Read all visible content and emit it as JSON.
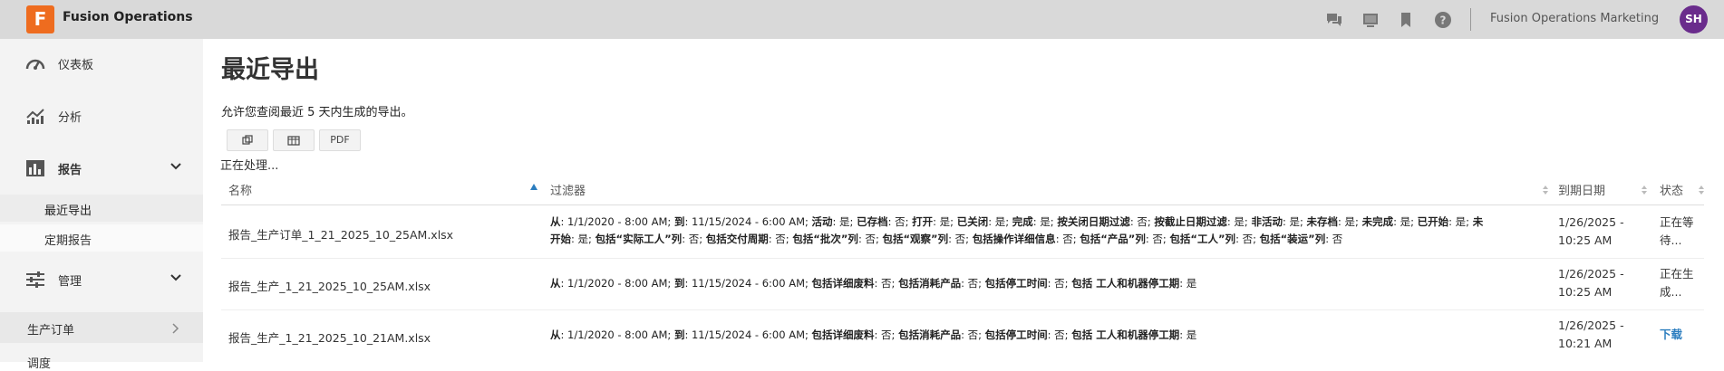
{
  "header": {
    "logo_letter": "F",
    "app_title": "Fusion Operations",
    "org_name": "Fusion Operations Marketing",
    "avatar_initials": "SH",
    "icons": [
      "chat-icon",
      "monitor-icon",
      "bookmark-icon",
      "help-icon"
    ]
  },
  "sidebar": {
    "items": [
      {
        "label": "仪表板",
        "icon": "dashboard-icon"
      },
      {
        "label": "分析",
        "icon": "analytics-icon"
      },
      {
        "label": "报告",
        "icon": "report-icon"
      },
      {
        "label": "管理",
        "icon": "settings-sliders-icon"
      }
    ],
    "report_sub": [
      "最近导出",
      "定期报告"
    ],
    "production_orders": "生产订单",
    "more_item": "调度"
  },
  "main": {
    "title": "最近导出",
    "description": "允许您查阅最近 5 天内生成的导出。",
    "buttons": {
      "copy": "copy-icon",
      "columns": "columns-icon",
      "pdf": "PDF"
    },
    "processing": "正在处理..."
  },
  "table": {
    "headers": {
      "name": "名称",
      "filter": "过滤器",
      "expiry": "到期日期",
      "status": "状态"
    },
    "rows": [
      {
        "name": "报告_生产订单_1_21_2025_10_25AM.xlsx",
        "filter_line1": [
          [
            "从",
            ": 1/1/2020 - 8:00 AM; "
          ],
          [
            "到",
            ": 11/15/2024 - 6:00 AM; "
          ],
          [
            "活动",
            ": 是; "
          ],
          [
            "已存档",
            ": 否; "
          ],
          [
            "打开",
            ": 是; "
          ],
          [
            "已关闭",
            ": 是; "
          ],
          [
            "完成",
            ": 是; "
          ],
          [
            "按关闭日期过滤",
            ": 否; "
          ],
          [
            "按截止日期过滤",
            ": 是; "
          ],
          [
            "非活动",
            ": 是; "
          ],
          [
            "未存档",
            ": 是; "
          ],
          [
            "未完成",
            ": 是; "
          ],
          [
            "已开始",
            ": 是; "
          ],
          [
            "未",
            ""
          ]
        ],
        "filter_line2": [
          [
            "开始",
            ": 是; "
          ],
          [
            "包括“实际工人”列",
            ": 否; "
          ],
          [
            "包括交付周期",
            ": 否; "
          ],
          [
            "包括“批次”列",
            ": 否; "
          ],
          [
            "包括“观察”列",
            ": 否; "
          ],
          [
            "包括操作详细信息",
            ": 否; "
          ],
          [
            "包括“产品”列",
            ": 否; "
          ],
          [
            "包括“工人”列",
            ": 否; "
          ],
          [
            "包括“装运”列",
            ": 否"
          ]
        ],
        "expiry_line1": "1/26/2025 -",
        "expiry_line2": "10:25 AM",
        "status_line1": "正在等",
        "status_line2": "待..."
      },
      {
        "name": "报告_生产_1_21_2025_10_25AM.xlsx",
        "filter_line1": [
          [
            "从",
            ": 1/1/2020 - 8:00 AM; "
          ],
          [
            "到",
            ": 11/15/2024 - 6:00 AM; "
          ],
          [
            "包括详细废料",
            ": 否; "
          ],
          [
            "包括消耗产品",
            ": 否; "
          ],
          [
            "包括停工时间",
            ": 否; "
          ],
          [
            "包括 工人和机器停工期",
            ": 是"
          ]
        ],
        "expiry_line1": "1/26/2025 -",
        "expiry_line2": "10:25 AM",
        "status_line1": "正在生",
        "status_line2": "成..."
      },
      {
        "name": "报告_生产_1_21_2025_10_21AM.xlsx",
        "filter_line1": [
          [
            "从",
            ": 1/1/2020 - 8:00 AM; "
          ],
          [
            "到",
            ": 11/15/2024 - 6:00 AM; "
          ],
          [
            "包括详细废料",
            ": 否; "
          ],
          [
            "包括消耗产品",
            ": 否; "
          ],
          [
            "包括停工时间",
            ": 否; "
          ],
          [
            "包括 工人和机器停工期",
            ": 是"
          ]
        ],
        "expiry_line1": "1/26/2025 -",
        "expiry_line2": "10:21 AM",
        "status_link": "下载"
      }
    ]
  },
  "colors": {
    "accent": "#2b7dbf",
    "logo": "#ee6c1f",
    "avatar": "#6a2c8c",
    "topbar": "#d9d9d9"
  }
}
